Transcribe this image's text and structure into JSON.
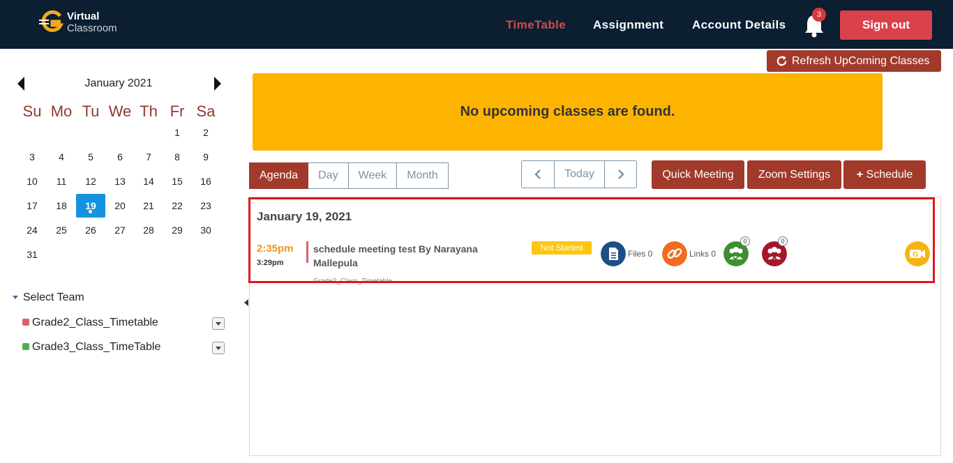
{
  "header": {
    "logo_line1": "Virtual",
    "logo_line2": "Classroom",
    "nav": {
      "timetable": "TimeTable",
      "assignment": "Assignment",
      "account": "Account  Details"
    },
    "notifications_count": "3",
    "signout": "Sign out"
  },
  "toolbar": {
    "refresh": "Refresh UpComing Classes"
  },
  "calendar": {
    "month": "January 2021",
    "weekdays": [
      "Su",
      "Mo",
      "Tu",
      "We",
      "Th",
      "Fr",
      "Sa"
    ],
    "weeks": [
      [
        "",
        "",
        "",
        "",
        "",
        "1",
        "2"
      ],
      [
        "3",
        "4",
        "5",
        "6",
        "7",
        "8",
        "9"
      ],
      [
        "10",
        "11",
        "12",
        "13",
        "14",
        "15",
        "16"
      ],
      [
        "17",
        "18",
        "19",
        "20",
        "21",
        "22",
        "23"
      ],
      [
        "24",
        "25",
        "26",
        "27",
        "28",
        "29",
        "30"
      ],
      [
        "31",
        "",
        "",
        "",
        "",
        "",
        ""
      ]
    ],
    "selected": "19"
  },
  "teams": {
    "header": "Select Team",
    "items": [
      {
        "label": "Grade2_Class_Timetable",
        "color": "#d9616a"
      },
      {
        "label": "Grade3_Class_TimeTable",
        "color": "#4caf50"
      }
    ]
  },
  "banner": {
    "text": "No upcoming classes are found."
  },
  "views": {
    "agenda": "Agenda",
    "day": "Day",
    "week": "Week",
    "month": "Month"
  },
  "navigation": {
    "today": "Today"
  },
  "actions": {
    "quick_meeting": "Quick Meeting",
    "zoom_settings": "Zoom Settings",
    "schedule": "Schedule"
  },
  "agenda": {
    "date": "January 19, 2021",
    "event": {
      "start": "2:35pm",
      "end": "3:29pm",
      "title": "schedule meeting test By Narayana Mallepula",
      "team": "Grade2_Class_Timetable",
      "status": "Not Started",
      "files_label": "Files 0",
      "links_label": "Links 0",
      "present_count": "0",
      "absent_count": "0"
    }
  },
  "colors": {
    "navbar": "#0b1e32",
    "accent": "#a13a2b",
    "banner": "#fdb400",
    "selected_day": "#1592de",
    "highlight": "#e0141e"
  }
}
